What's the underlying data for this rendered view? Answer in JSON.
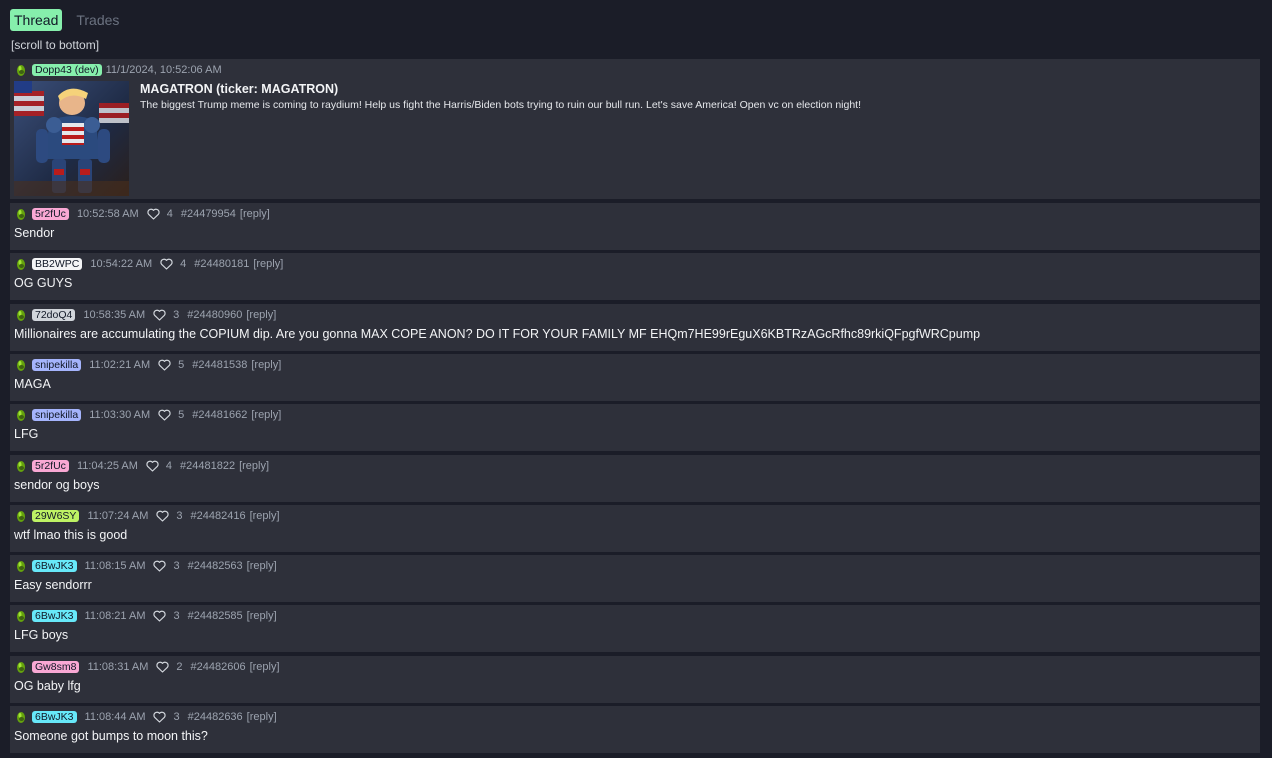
{
  "tabs": [
    {
      "label": "Thread",
      "active": true
    },
    {
      "label": "Trades",
      "active": false
    }
  ],
  "scroll_link": "[scroll to bottom]",
  "colors": {
    "background": "#1b1d28",
    "card": "#2e303a",
    "active_tab": "#86efac"
  },
  "op": {
    "user": "Dopp43 (dev)",
    "user_color": "#86efac",
    "timestamp": "11/1/2024, 10:52:06 AM",
    "title": "MAGATRON (ticker: MAGATRON)",
    "text": "The biggest Trump meme is coming to raydium! Help us fight the Harris/Biden bots trying to ruin our bull run. Let's save America! Open vc on election night!"
  },
  "replies": [
    {
      "user": "5r2fUc",
      "color": "#f9a8d4",
      "time": "10:52:58 AM",
      "likes": "4",
      "id": "#24479954",
      "reply": "[reply]",
      "text": "Sendor"
    },
    {
      "user": "BB2WPC",
      "color": "#f3f4f6",
      "time": "10:54:22 AM",
      "likes": "4",
      "id": "#24480181",
      "reply": "[reply]",
      "text": "OG GUYS"
    },
    {
      "user": "72doQ4",
      "color": "#d1d5db",
      "time": "10:58:35 AM",
      "likes": "3",
      "id": "#24480960",
      "reply": "[reply]",
      "text": "Millionaires are accumulating the COPIUM dip. Are you gonna MAX COPE ANON? DO IT FOR YOUR FAMILY MF EHQm7HE99rEguX6KBTRzAGcRfhc89rkiQFpgfWRCpump"
    },
    {
      "user": "snipekilla",
      "color": "#a5b4fc",
      "time": "11:02:21 AM",
      "likes": "5",
      "id": "#24481538",
      "reply": "[reply]",
      "text": "MAGA"
    },
    {
      "user": "snipekilla",
      "color": "#a5b4fc",
      "time": "11:03:30 AM",
      "likes": "5",
      "id": "#24481662",
      "reply": "[reply]",
      "text": "LFG"
    },
    {
      "user": "5r2fUc",
      "color": "#f9a8d4",
      "time": "11:04:25 AM",
      "likes": "4",
      "id": "#24481822",
      "reply": "[reply]",
      "text": "sendor og boys"
    },
    {
      "user": "29W6SY",
      "color": "#bef264",
      "time": "11:07:24 AM",
      "likes": "3",
      "id": "#24482416",
      "reply": "[reply]",
      "text": "wtf lmao this is good"
    },
    {
      "user": "6BwJK3",
      "color": "#67e8f9",
      "time": "11:08:15 AM",
      "likes": "3",
      "id": "#24482563",
      "reply": "[reply]",
      "text": "Easy sendorrr"
    },
    {
      "user": "6BwJK3",
      "color": "#67e8f9",
      "time": "11:08:21 AM",
      "likes": "3",
      "id": "#24482585",
      "reply": "[reply]",
      "text": "LFG boys"
    },
    {
      "user": "Gw8sm8",
      "color": "#f9a8d4",
      "time": "11:08:31 AM",
      "likes": "2",
      "id": "#24482606",
      "reply": "[reply]",
      "text": "OG baby lfg"
    },
    {
      "user": "6BwJK3",
      "color": "#67e8f9",
      "time": "11:08:44 AM",
      "likes": "3",
      "id": "#24482636",
      "reply": "[reply]",
      "text": "Someone got bumps to moon this?"
    }
  ]
}
